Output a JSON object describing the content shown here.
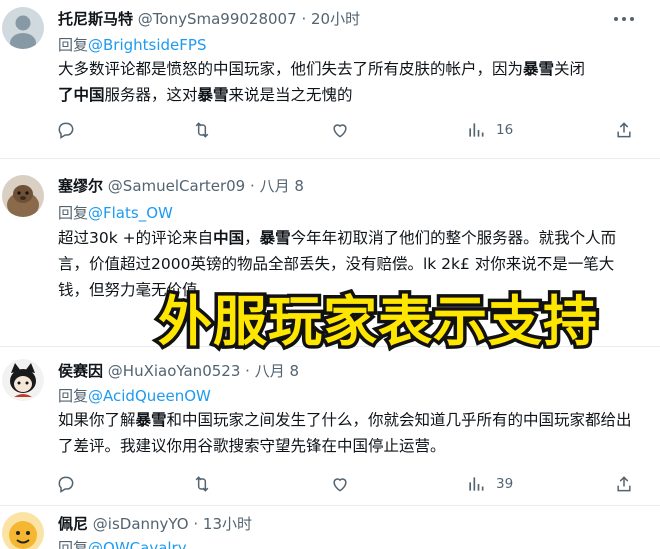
{
  "tweets": [
    {
      "name": "托尼斯马特",
      "handle": "@TonySma99028007",
      "sep": "·",
      "time": "20小时",
      "reply_prefix": "回复",
      "reply_to": "@BrightsideFPS",
      "body": [
        {
          "t": "大多数评论都是愤怒的中国玩家，他们失去了所有皮肤的帐户，因为",
          "b": false
        },
        {
          "t": "暴雪",
          "b": true
        },
        {
          "t": "关闭",
          "b": false
        },
        {
          "t": "了中国",
          "b": true
        },
        {
          "t": "服务器，这对",
          "b": false
        },
        {
          "t": "暴雪",
          "b": true
        },
        {
          "t": "来说是当之无愧的",
          "b": false
        }
      ],
      "views": "16"
    },
    {
      "name": "塞缪尔",
      "handle": "@SamuelCarter09",
      "sep": "·",
      "time": "八月 8",
      "reply_prefix": "回复",
      "reply_to": "@Flats_OW",
      "body": [
        {
          "t": "超过30k +的评论来自",
          "b": false
        },
        {
          "t": "中国",
          "b": true
        },
        {
          "t": "，",
          "b": false
        },
        {
          "t": "暴雪",
          "b": true
        },
        {
          "t": "今年年初取消了他们的整个服务器。就我个人而言，价值超过2000英镑的物品全部丢失，没有赔偿。lk 2k£ 对你来说不是一笔大钱，但努力毫无价值",
          "b": false
        }
      ]
    },
    {
      "name": "侯赛因",
      "handle": "@HuXiaoYan0523",
      "sep": "·",
      "time": "八月 8",
      "reply_prefix": "回复",
      "reply_to": "@AcidQueenOW",
      "body": [
        {
          "t": "如果你了解",
          "b": false
        },
        {
          "t": "暴雪",
          "b": true
        },
        {
          "t": "和中国玩家之间发生了什么，你就会知道几乎所有的中国玩家都给出了差评。我建议你用谷歌搜索守望先锋在中国停止运营。",
          "b": false
        }
      ],
      "views": "39"
    },
    {
      "name": "佩尼",
      "handle": "@isDannyYO",
      "sep": "·",
      "time": "13小时",
      "reply_prefix": "回复",
      "reply_to": "@OWCavalry"
    }
  ],
  "overlay_caption": "外服玩家表示支持",
  "icons": {
    "reply": "reply-icon",
    "retweet": "retweet-icon",
    "like": "like-icon",
    "views": "views-icon",
    "share": "share-icon",
    "more": "more-icon"
  },
  "colors": {
    "link": "#1d9bf0",
    "secondary_text": "#536471",
    "caption_fill": "#ffe600",
    "caption_stroke": "#111111"
  }
}
